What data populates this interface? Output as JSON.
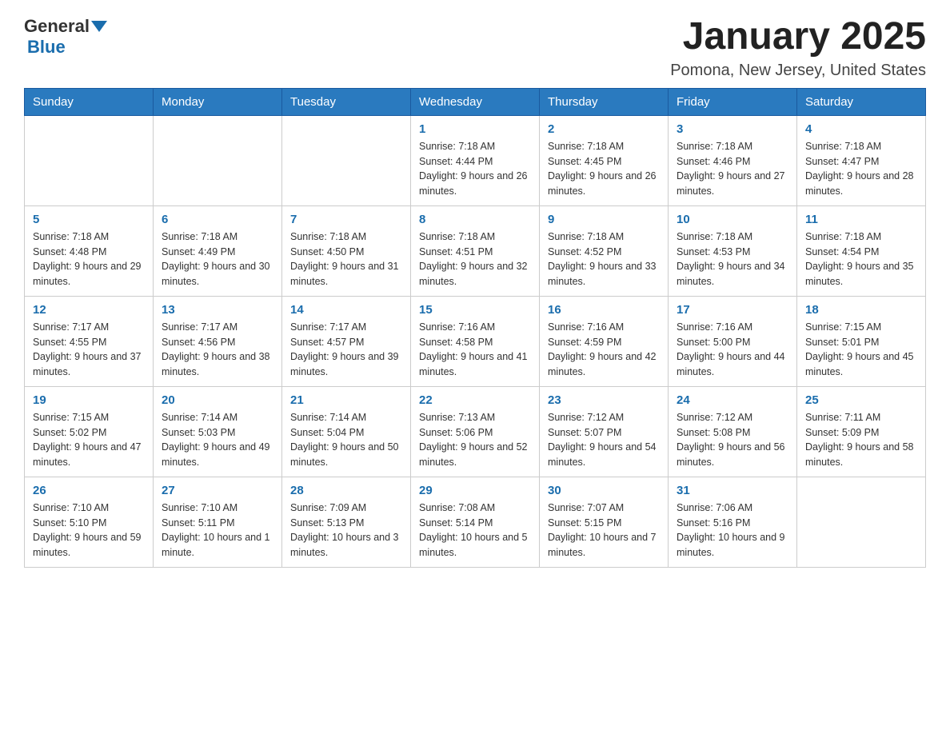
{
  "header": {
    "logo_general": "General",
    "logo_blue": "Blue",
    "title": "January 2025",
    "location": "Pomona, New Jersey, United States"
  },
  "days_of_week": [
    "Sunday",
    "Monday",
    "Tuesday",
    "Wednesday",
    "Thursday",
    "Friday",
    "Saturday"
  ],
  "weeks": [
    [
      {
        "day": "",
        "info": ""
      },
      {
        "day": "",
        "info": ""
      },
      {
        "day": "",
        "info": ""
      },
      {
        "day": "1",
        "info": "Sunrise: 7:18 AM\nSunset: 4:44 PM\nDaylight: 9 hours\nand 26 minutes."
      },
      {
        "day": "2",
        "info": "Sunrise: 7:18 AM\nSunset: 4:45 PM\nDaylight: 9 hours\nand 26 minutes."
      },
      {
        "day": "3",
        "info": "Sunrise: 7:18 AM\nSunset: 4:46 PM\nDaylight: 9 hours\nand 27 minutes."
      },
      {
        "day": "4",
        "info": "Sunrise: 7:18 AM\nSunset: 4:47 PM\nDaylight: 9 hours\nand 28 minutes."
      }
    ],
    [
      {
        "day": "5",
        "info": "Sunrise: 7:18 AM\nSunset: 4:48 PM\nDaylight: 9 hours\nand 29 minutes."
      },
      {
        "day": "6",
        "info": "Sunrise: 7:18 AM\nSunset: 4:49 PM\nDaylight: 9 hours\nand 30 minutes."
      },
      {
        "day": "7",
        "info": "Sunrise: 7:18 AM\nSunset: 4:50 PM\nDaylight: 9 hours\nand 31 minutes."
      },
      {
        "day": "8",
        "info": "Sunrise: 7:18 AM\nSunset: 4:51 PM\nDaylight: 9 hours\nand 32 minutes."
      },
      {
        "day": "9",
        "info": "Sunrise: 7:18 AM\nSunset: 4:52 PM\nDaylight: 9 hours\nand 33 minutes."
      },
      {
        "day": "10",
        "info": "Sunrise: 7:18 AM\nSunset: 4:53 PM\nDaylight: 9 hours\nand 34 minutes."
      },
      {
        "day": "11",
        "info": "Sunrise: 7:18 AM\nSunset: 4:54 PM\nDaylight: 9 hours\nand 35 minutes."
      }
    ],
    [
      {
        "day": "12",
        "info": "Sunrise: 7:17 AM\nSunset: 4:55 PM\nDaylight: 9 hours\nand 37 minutes."
      },
      {
        "day": "13",
        "info": "Sunrise: 7:17 AM\nSunset: 4:56 PM\nDaylight: 9 hours\nand 38 minutes."
      },
      {
        "day": "14",
        "info": "Sunrise: 7:17 AM\nSunset: 4:57 PM\nDaylight: 9 hours\nand 39 minutes."
      },
      {
        "day": "15",
        "info": "Sunrise: 7:16 AM\nSunset: 4:58 PM\nDaylight: 9 hours\nand 41 minutes."
      },
      {
        "day": "16",
        "info": "Sunrise: 7:16 AM\nSunset: 4:59 PM\nDaylight: 9 hours\nand 42 minutes."
      },
      {
        "day": "17",
        "info": "Sunrise: 7:16 AM\nSunset: 5:00 PM\nDaylight: 9 hours\nand 44 minutes."
      },
      {
        "day": "18",
        "info": "Sunrise: 7:15 AM\nSunset: 5:01 PM\nDaylight: 9 hours\nand 45 minutes."
      }
    ],
    [
      {
        "day": "19",
        "info": "Sunrise: 7:15 AM\nSunset: 5:02 PM\nDaylight: 9 hours\nand 47 minutes."
      },
      {
        "day": "20",
        "info": "Sunrise: 7:14 AM\nSunset: 5:03 PM\nDaylight: 9 hours\nand 49 minutes."
      },
      {
        "day": "21",
        "info": "Sunrise: 7:14 AM\nSunset: 5:04 PM\nDaylight: 9 hours\nand 50 minutes."
      },
      {
        "day": "22",
        "info": "Sunrise: 7:13 AM\nSunset: 5:06 PM\nDaylight: 9 hours\nand 52 minutes."
      },
      {
        "day": "23",
        "info": "Sunrise: 7:12 AM\nSunset: 5:07 PM\nDaylight: 9 hours\nand 54 minutes."
      },
      {
        "day": "24",
        "info": "Sunrise: 7:12 AM\nSunset: 5:08 PM\nDaylight: 9 hours\nand 56 minutes."
      },
      {
        "day": "25",
        "info": "Sunrise: 7:11 AM\nSunset: 5:09 PM\nDaylight: 9 hours\nand 58 minutes."
      }
    ],
    [
      {
        "day": "26",
        "info": "Sunrise: 7:10 AM\nSunset: 5:10 PM\nDaylight: 9 hours\nand 59 minutes."
      },
      {
        "day": "27",
        "info": "Sunrise: 7:10 AM\nSunset: 5:11 PM\nDaylight: 10 hours\nand 1 minute."
      },
      {
        "day": "28",
        "info": "Sunrise: 7:09 AM\nSunset: 5:13 PM\nDaylight: 10 hours\nand 3 minutes."
      },
      {
        "day": "29",
        "info": "Sunrise: 7:08 AM\nSunset: 5:14 PM\nDaylight: 10 hours\nand 5 minutes."
      },
      {
        "day": "30",
        "info": "Sunrise: 7:07 AM\nSunset: 5:15 PM\nDaylight: 10 hours\nand 7 minutes."
      },
      {
        "day": "31",
        "info": "Sunrise: 7:06 AM\nSunset: 5:16 PM\nDaylight: 10 hours\nand 9 minutes."
      },
      {
        "day": "",
        "info": ""
      }
    ]
  ]
}
